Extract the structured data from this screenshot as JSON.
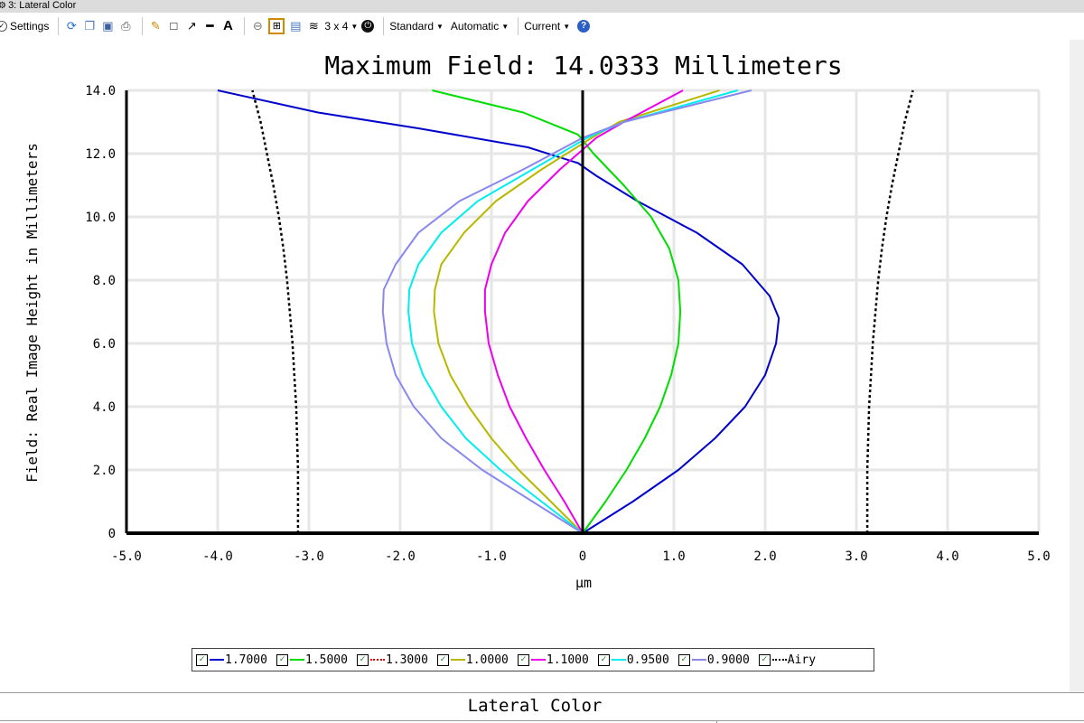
{
  "window": {
    "title": "3: Lateral Color"
  },
  "toolbar": {
    "settings_label": "Settings",
    "layout_label": "3 x 4",
    "standard_label": "Standard",
    "automatic_label": "Automatic",
    "current_label": "Current"
  },
  "chart_data": {
    "type": "line",
    "title": "Maximum Field: 14.0333 Millimeters",
    "xlabel": "µm",
    "ylabel": "Field: Real Image Height in Millimeters",
    "xlim": [
      -5.0,
      5.0
    ],
    "ylim": [
      0,
      14.0
    ],
    "xticks": [
      "-5.0",
      "-4.0",
      "-3.0",
      "-2.0",
      "-1.0",
      "0",
      "1.0",
      "2.0",
      "3.0",
      "4.0",
      "5.0"
    ],
    "yticks": [
      "0",
      "2.0",
      "4.0",
      "6.0",
      "8.0",
      "10.0",
      "12.0",
      "14.0"
    ],
    "grid": true,
    "legend_position": "bottom",
    "series": [
      {
        "name": "1.7000",
        "color": "#0000cc",
        "y": [
          0,
          1,
          2,
          3,
          4,
          5,
          6,
          6.8,
          7.5,
          8.5,
          9.5,
          10.5,
          11.3,
          11.7,
          12.2,
          12.8,
          13.3,
          14.0
        ],
        "x": [
          0,
          0.55,
          1.05,
          1.45,
          1.78,
          2.0,
          2.12,
          2.15,
          2.05,
          1.75,
          1.25,
          0.6,
          0.15,
          -0.05,
          -0.6,
          -1.8,
          -2.9,
          -4.0
        ]
      },
      {
        "name": "1.5000",
        "color": "#00dd00",
        "y": [
          0,
          1,
          2,
          3,
          4,
          5,
          6,
          7,
          8,
          9,
          10,
          11,
          12,
          12.6,
          13.3,
          14.0
        ],
        "x": [
          0,
          0.25,
          0.48,
          0.68,
          0.85,
          0.97,
          1.05,
          1.07,
          1.05,
          0.95,
          0.75,
          0.45,
          0.12,
          -0.05,
          -0.65,
          -1.65
        ]
      },
      {
        "name": "1.3000",
        "color": "#ee0000",
        "y": [
          0,
          14.0
        ],
        "x": [
          0,
          0
        ],
        "dash": "10,30"
      },
      {
        "name": "1.0000",
        "color": "#b8b800",
        "y": [
          0,
          1,
          2,
          3,
          4,
          5,
          6,
          7,
          7.7,
          8.5,
          9.5,
          10.5,
          11.5,
          12.5,
          13.0,
          14.0
        ],
        "x": [
          0,
          -0.35,
          -0.7,
          -1.0,
          -1.25,
          -1.45,
          -1.58,
          -1.63,
          -1.62,
          -1.55,
          -1.3,
          -0.95,
          -0.45,
          0.1,
          0.4,
          1.5
        ]
      },
      {
        "name": "1.1000",
        "color": "#ee00ee",
        "y": [
          0,
          1,
          2,
          3,
          4,
          5,
          6,
          7,
          7.7,
          8.5,
          9.5,
          10.5,
          11.5,
          12.5,
          13.0,
          14.0
        ],
        "x": [
          0,
          -0.2,
          -0.42,
          -0.62,
          -0.8,
          -0.93,
          -1.03,
          -1.07,
          -1.07,
          -1.0,
          -0.85,
          -0.6,
          -0.25,
          0.15,
          0.45,
          1.1
        ]
      },
      {
        "name": "0.9500",
        "color": "#00eeee",
        "y": [
          0,
          1,
          2,
          3,
          4,
          5,
          6,
          7,
          7.7,
          8.5,
          9.5,
          10.5,
          11.5,
          12.5,
          13.0,
          14.0
        ],
        "x": [
          0,
          -0.45,
          -0.9,
          -1.28,
          -1.55,
          -1.75,
          -1.87,
          -1.91,
          -1.9,
          -1.8,
          -1.55,
          -1.15,
          -0.55,
          0.05,
          0.45,
          1.7
        ]
      },
      {
        "name": "0.9000",
        "color": "#8888ee",
        "y": [
          0,
          1,
          2,
          3,
          4,
          5,
          6,
          7,
          7.7,
          8.5,
          9.5,
          10.5,
          11.5,
          12.5,
          13.0,
          14.0
        ],
        "x": [
          0,
          -0.55,
          -1.1,
          -1.55,
          -1.85,
          -2.05,
          -2.15,
          -2.19,
          -2.18,
          -2.05,
          -1.8,
          -1.35,
          -0.65,
          0.0,
          0.45,
          1.85
        ]
      },
      {
        "name": "Airy",
        "color": "#000000",
        "dash": "3,3",
        "y": [
          0,
          1,
          2,
          3,
          4,
          5,
          6,
          7,
          8,
          9,
          10,
          11,
          12,
          13,
          14.0
        ],
        "x": [
          3.12,
          3.12,
          3.12,
          3.13,
          3.14,
          3.16,
          3.18,
          3.21,
          3.24,
          3.28,
          3.33,
          3.39,
          3.46,
          3.53,
          3.62
        ]
      }
    ]
  },
  "footer": {
    "label": "Lateral Color"
  }
}
